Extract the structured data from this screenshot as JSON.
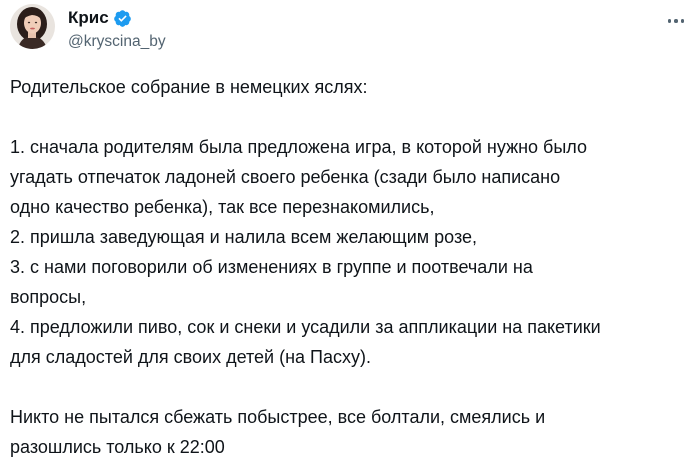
{
  "author": {
    "display_name": "Крис",
    "handle": "@kryscina_by",
    "avatar_icon": "user-avatar-photo",
    "verified_icon": "verified-badge-icon",
    "verified_color": "#1d9bf0"
  },
  "menu": {
    "icon": "more-options-icon"
  },
  "tweet": {
    "lines": [
      "Родительское собрание в немецких яслях:",
      "",
      "1. сначала родителям была предложена игра, в которой нужно было",
      "угадать отпечаток ладоней своего ребенка (сзади было написано",
      "одно качество ребенка), так все перезнакомились,",
      "2. пришла заведующая и налила всем желающим розе,",
      "3. с нами поговорили об изменениях в группе и поотвечали на",
      "вопросы,",
      "4. предложили пиво, сок и снеки и усадили за аппликации на пакетики",
      "для сладостей для своих детей (на Пасху).",
      "",
      "Никто не пытался сбежать побыстрее, все болтали, смеялись и",
      "разошлись только к 22:00"
    ]
  }
}
